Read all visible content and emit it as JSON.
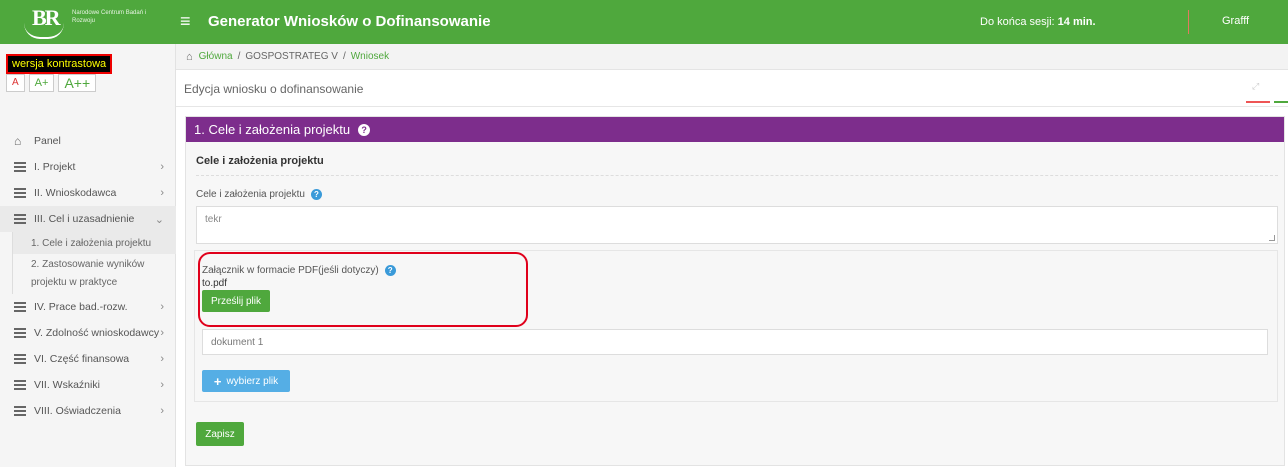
{
  "header": {
    "logo_text": "BR",
    "logo_sub": "Narodowe Centrum Badań i Rozwoju",
    "title": "Generator Wniosków o Dofinansowanie",
    "session_label": "Do końca sesji:",
    "session_value": "14 min.",
    "user": "Grafff"
  },
  "accessibility": {
    "contrast_label": "wersja kontrastowa",
    "font_small": "A",
    "font_medium": "A+",
    "font_large": "A++"
  },
  "sidebar": {
    "items": [
      {
        "label": "Panel"
      },
      {
        "label": "I. Projekt"
      },
      {
        "label": "II. Wnioskodawca"
      },
      {
        "label": "III. Cel i uzasadnienie"
      },
      {
        "label": "IV. Prace bad.-rozw."
      },
      {
        "label": "V. Zdolność wnioskodawcy"
      },
      {
        "label": "VI. Część finansowa"
      },
      {
        "label": "VII. Wskaźniki"
      },
      {
        "label": "VIII. Oświadczenia"
      }
    ],
    "subitems": [
      {
        "label": "1. Cele i założenia projektu"
      },
      {
        "label": "2. Zastosowanie wyników projektu w praktyce"
      }
    ]
  },
  "breadcrumb": {
    "home": "Główna",
    "mid": "GOSPOSTRATEG V",
    "current": "Wniosek"
  },
  "page": {
    "title": "Edycja wniosku o dofinansowanie"
  },
  "panel": {
    "title": "1. Cele i założenia projektu",
    "section_title": "Cele i założenia projektu",
    "field_label": "Cele i założenia projektu",
    "field_value": "tekr",
    "attach_label": "Załącznik w formacie PDF(jeśli dotyczy)",
    "attach_file": "to.pdf",
    "send_button": "Prześlij plik",
    "doc_value": "dokument 1",
    "choose_button": "wybierz plik",
    "save_button": "Zapisz"
  },
  "colors": {
    "brand": "#4fa83d",
    "panel_header": "#7d2d8c",
    "highlight": "#e0001b"
  }
}
